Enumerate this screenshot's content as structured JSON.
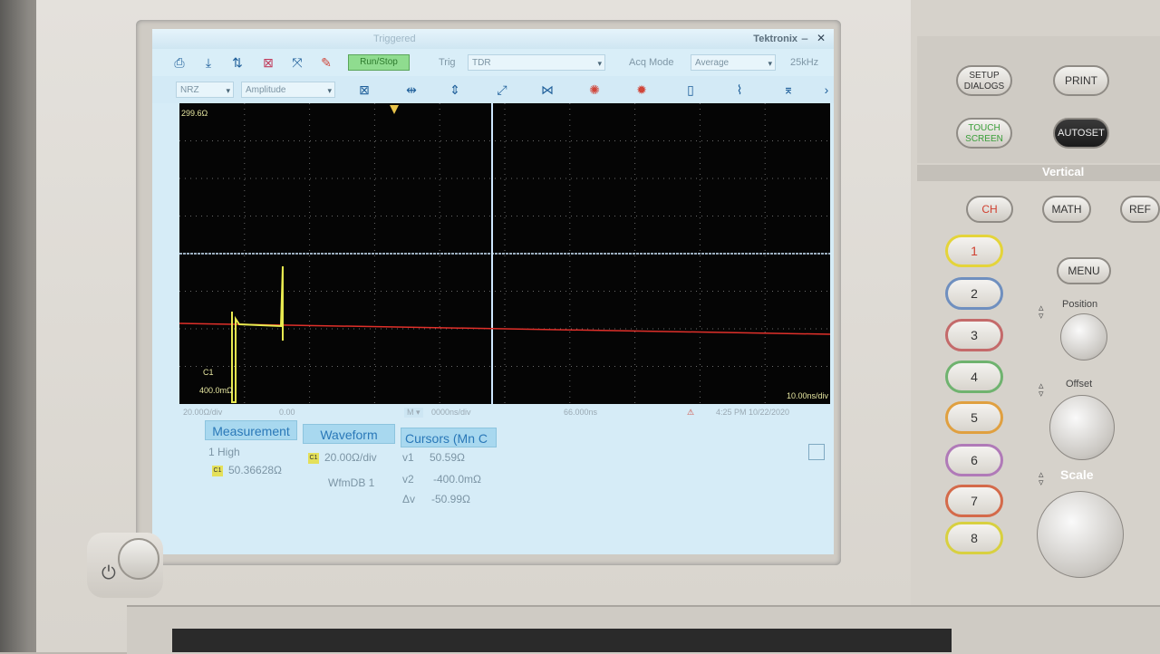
{
  "window": {
    "status_title": "Triggered",
    "brand": "Tektronix",
    "minimize_glyph": "–",
    "close_glyph": "✕"
  },
  "toolbar": {
    "run_stop_label": "Run/Stop",
    "trig_label": "Trig",
    "trig_value": "TDR",
    "acq_mode_label": "Acq Mode",
    "acq_mode_value": "Average",
    "rate_label": "25kHz",
    "format_value": "NRZ",
    "measure_value": "Amplitude"
  },
  "graticule": {
    "top_readout": "299.6Ω",
    "channel_label": "C1",
    "bottom_readout": "400.0mΩ",
    "time_scale": "10.00ns/div"
  },
  "status_row": {
    "vertical_scale": "20.00Ω/div",
    "offset": "0.00",
    "horizontal_pos": "0000ns/div",
    "position": "66.000ns",
    "timestamp": "4:25 PM 10/22/2020"
  },
  "measurement_panel": {
    "title": "Measurement",
    "row_label": "1 High",
    "row_value": "50.36628Ω",
    "channel_tag": "C1"
  },
  "waveform_panel": {
    "title": "Waveform",
    "scale_value": "20.00Ω/div",
    "db_value": "WfmDB 1",
    "channel_tag": "C1"
  },
  "cursors_panel": {
    "title": "Cursors (Mn C",
    "v1_label": "v1",
    "v1_value": "50.59Ω",
    "v2_label": "v2",
    "v2_value": "-400.0mΩ",
    "dv_label": "Δv",
    "dv_value": "-50.99Ω"
  },
  "front_panel": {
    "setup_dialogs": "SETUP DIALOGS",
    "print": "PRINT",
    "touch_screen": "TOUCH SCREEN",
    "autoset": "AUTOSET",
    "vertical": "Vertical",
    "ch": "CH",
    "math": "MATH",
    "ref": "REF",
    "menu": "MENU",
    "position": "Position",
    "offset": "Offset",
    "scale": "Scale",
    "channels": [
      "1",
      "2",
      "3",
      "4",
      "5",
      "6",
      "7",
      "8"
    ],
    "channel_colors": [
      "#e4d43a",
      "#6f8fbf",
      "#c46a6a",
      "#6fb36f",
      "#e0a040",
      "#b07ab8",
      "#d46a4a",
      "#d8d040"
    ]
  },
  "colors": {
    "trace_yellow": "#e8ea50",
    "trace_red": "#e0302a",
    "marker_blue": "#cfe8ff",
    "accent_blue": "#2a78b8"
  }
}
